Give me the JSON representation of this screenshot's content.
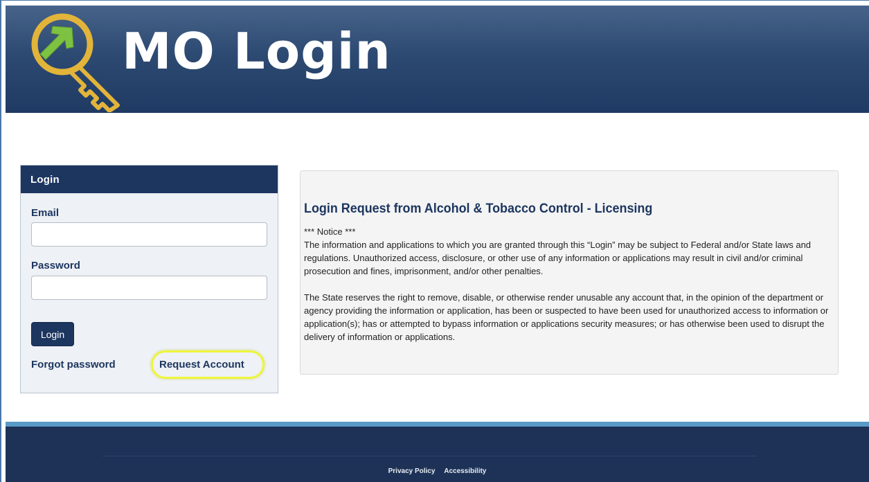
{
  "header": {
    "logo_text": "MO Login",
    "colors": {
      "bg": "#2d4a72",
      "key_outline": "#e2b43a",
      "key_arrow": "#7ec242"
    }
  },
  "login": {
    "panel_title": "Login",
    "email_label": "Email",
    "email_value": "",
    "password_label": "Password",
    "password_value": "",
    "login_button": "Login",
    "forgot_password": "Forgot password",
    "request_account": "Request Account"
  },
  "notice": {
    "title": "Login Request from Alcohol & Tobacco Control - Licensing",
    "notice_heading": "*** Notice ***",
    "paragraph1": "The information and applications to which you are granted through this “Login” may be subject to Federal and/or State laws and regulations. Unauthorized access, disclosure, or other use of any information or applications may result in civil and/or criminal prosecution and fines, imprisonment, and/or other penalties.",
    "paragraph2": "The State reserves the right to remove, disable, or otherwise render unusable any account that, in the opinion of the department or agency providing the information or application, has been or suspected to have been used for unauthorized access to information or application(s); has or attempted to bypass information or applications security measures; or has otherwise been used to disrupt the delivery of information or applications."
  },
  "footer": {
    "privacy_policy": "Privacy Policy",
    "accessibility": "Accessibility"
  },
  "colors": {
    "navy": "#1d3660",
    "highlight": "#eef53a",
    "footer_accent": "#5a9ac7"
  }
}
